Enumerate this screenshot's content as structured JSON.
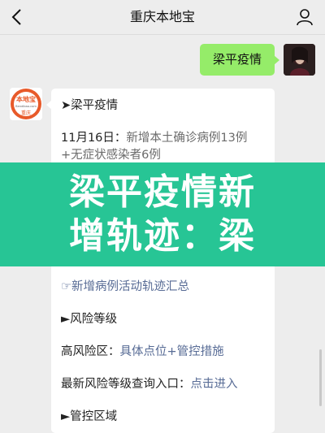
{
  "nav": {
    "title": "重庆本地宝"
  },
  "outgoing": {
    "text": "梁平疫情"
  },
  "account_avatar": {
    "logo_top": "本地宝",
    "logo_domain": "Bendibao.com",
    "logo_city": "重庆"
  },
  "card": {
    "heading": "➤梁平疫情",
    "date_label": "11月16日",
    "date_colon": "：",
    "case_line1": "新增本土确诊病例13例",
    "case_line2": "+无症状感染者6例",
    "track_link": "☞新增病例活动轨迹汇总",
    "risk_heading": "►风险等级",
    "high_risk_label": "高风险区：",
    "high_risk_link": "具体点位+管控措施",
    "query_label": "最新风险等级查询入口：",
    "query_link": "点击进入",
    "control_heading": "►管控区域"
  },
  "banner": {
    "line1": "梁平疫情新",
    "line2": "增轨迹：梁",
    "color": "#27c595"
  }
}
